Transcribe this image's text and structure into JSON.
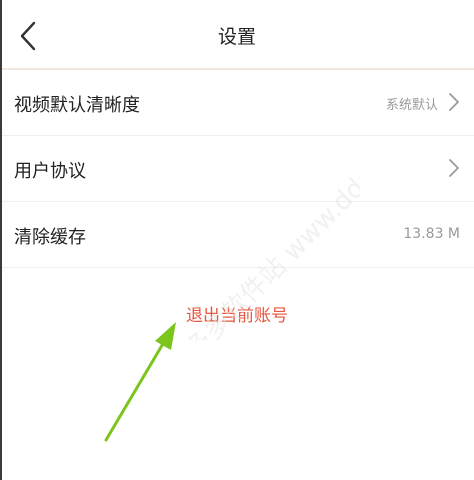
{
  "header": {
    "title": "设置",
    "back_icon": "chevron-left-icon"
  },
  "menu": [
    {
      "label": "视频默认清晰度",
      "value": "系统默认",
      "chevron": true
    },
    {
      "label": "用户协议",
      "value": "",
      "chevron": true
    },
    {
      "label": "清除缓存",
      "value": "13.83 M",
      "chevron": false
    }
  ],
  "logout": {
    "label": "退出当前账号"
  },
  "annotation": {
    "icon": "arrow-pointer-icon",
    "color": "#7cc51c"
  },
  "watermark": {
    "text": "多多软件站 www.ddooo.com"
  },
  "colors": {
    "accent_red": "#e8563f",
    "secondary_text": "#9a9a9a",
    "divider": "#f0eeee"
  }
}
